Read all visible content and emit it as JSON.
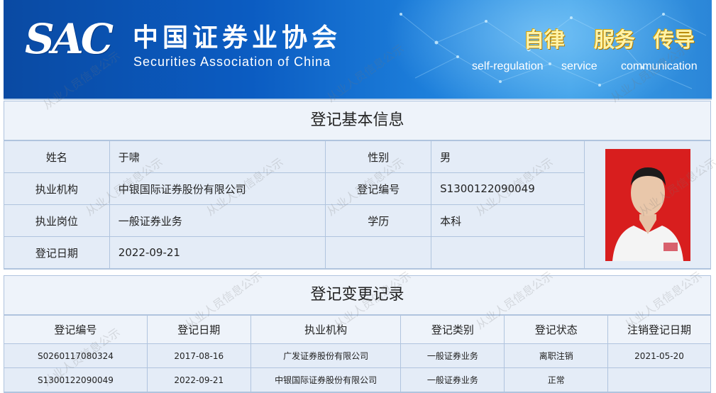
{
  "header": {
    "logo_abbr": "SAC",
    "org_name_cn": "中国证券业协会",
    "org_name_en": "Securities Association of China",
    "slogans": [
      {
        "cn": "自律",
        "en": "self-regulation"
      },
      {
        "cn": "服务",
        "en": "service"
      },
      {
        "cn": "传导",
        "en": "communication"
      }
    ]
  },
  "basic_info": {
    "title": "登记基本信息",
    "name_label": "姓名",
    "name_value": "于啸",
    "gender_label": "性别",
    "gender_value": "男",
    "org_label": "执业机构",
    "org_value": "中银国际证券股份有限公司",
    "reg_no_label": "登记编号",
    "reg_no_value": "S1300122090049",
    "position_label": "执业岗位",
    "position_value": "一般证券业务",
    "education_label": "学历",
    "education_value": "本科",
    "reg_date_label": "登记日期",
    "reg_date_value": "2022-09-21"
  },
  "records": {
    "title": "登记变更记录",
    "columns": [
      "登记编号",
      "登记日期",
      "执业机构",
      "登记类别",
      "登记状态",
      "注销登记日期"
    ],
    "rows": [
      [
        "S0260117080324",
        "2017-08-16",
        "广发证券股份有限公司",
        "一般证券业务",
        "离职注销",
        "2021-05-20"
      ],
      [
        "S1300122090049",
        "2022-09-21",
        "中银国际证券股份有限公司",
        "一般证券业务",
        "正常",
        ""
      ]
    ]
  },
  "watermark": "从业人员信息公示",
  "colors": {
    "banner": "#0b5cc2",
    "border": "#b0c4de",
    "cell_bg": "#e4ecf7",
    "photo_bg": "#d81e1e",
    "slogan": "#fff3a8"
  }
}
